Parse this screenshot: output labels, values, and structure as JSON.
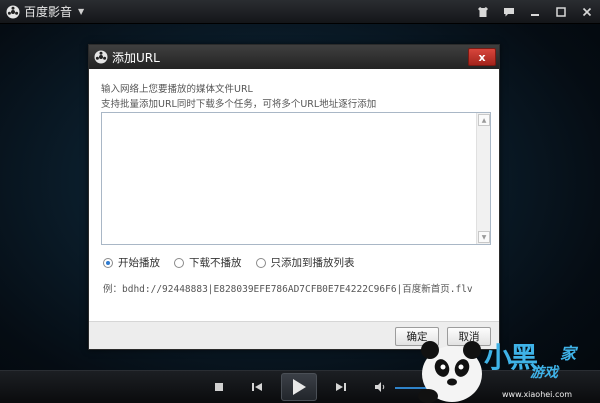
{
  "app": {
    "title": "百度影音",
    "menu_arrow": "▼"
  },
  "titlebar_icons": [
    "skin-icon",
    "message-icon",
    "minimize-icon",
    "maximize-icon",
    "close-icon"
  ],
  "dialog": {
    "title": "添加URL",
    "close_label": "x",
    "desc_line1": "输入网络上您要播放的媒体文件URL",
    "desc_line2": "支持批量添加URL同时下载多个任务，可将多个URL地址逐行添加",
    "url_value": "",
    "options": [
      {
        "label": "开始播放",
        "selected": true
      },
      {
        "label": "下载不播放",
        "selected": false
      },
      {
        "label": "只添加到播放列表",
        "selected": false
      }
    ],
    "example": "例：bdhd://92448883|E828039EFE786AD7CFB0E7E4222C96F6|百度新首页.flv",
    "ok_label": "确定",
    "cancel_label": "取消"
  },
  "watermark": {
    "brand": "小黑",
    "home": "家",
    "game": "游戏",
    "url": "www.xiaohei.com"
  },
  "colors": {
    "accent": "#2f7bd0",
    "close_red": "#c0392b",
    "watermark_blue": "#3fb3e8"
  }
}
